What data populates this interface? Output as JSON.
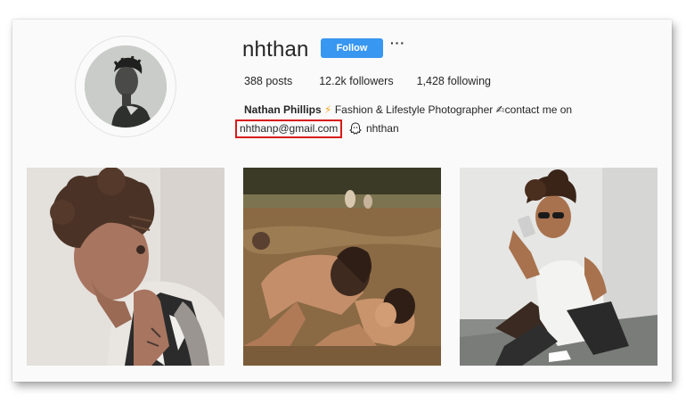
{
  "profile": {
    "username": "nhthan",
    "follow_label": "Follow",
    "more_label": "···",
    "stats": {
      "posts": "388 posts",
      "followers": "12.2k followers",
      "following": "1,428 following"
    },
    "bio": {
      "name": "Nathan Phillips",
      "bolt": "⚡",
      "line1_text": "Fashion & Lifestyle Photographer",
      "line1_suffix": "contact me on",
      "contact_symbol": "✍",
      "email": "nhthanp@gmail.com",
      "snapchat_icon": "ghost-icon",
      "handle": "nhthan"
    }
  },
  "colors": {
    "follow_button": "#3897f0",
    "highlight_box": "#d81a1a",
    "text": "#262626"
  },
  "posts": [
    {
      "name": "post-curly-hair-portrait"
    },
    {
      "name": "post-river-swimmers"
    },
    {
      "name": "post-selfie-sunglasses"
    }
  ]
}
